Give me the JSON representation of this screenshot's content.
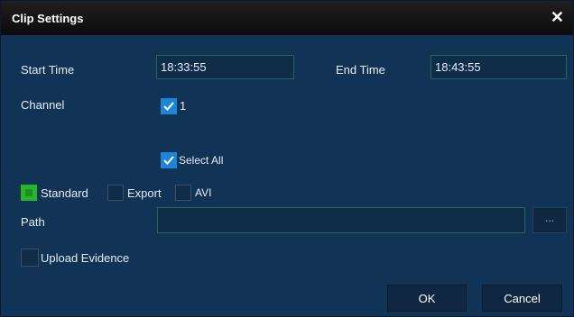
{
  "dialog": {
    "title": "Clip Settings",
    "close_glyph": "✕"
  },
  "time": {
    "start_label": "Start Time",
    "start_value": "18:33:55",
    "end_label": "End Time",
    "end_value": "18:43:55"
  },
  "channel": {
    "label": "Channel",
    "items": [
      {
        "label": "1",
        "checked": true
      }
    ],
    "select_all_label": "Select All",
    "select_all_checked": true
  },
  "format": {
    "options": [
      {
        "label": "Standard",
        "selected": true
      },
      {
        "label": "Export",
        "selected": false
      },
      {
        "label": "AVI",
        "selected": false
      }
    ]
  },
  "path": {
    "label": "Path",
    "value": "",
    "browse_label": "..."
  },
  "upload": {
    "label": "Upload Evidence",
    "checked": false
  },
  "buttons": {
    "ok": "OK",
    "cancel": "Cancel"
  },
  "colors": {
    "background": "#113355",
    "checkbox_checked": "#1b86d6",
    "radio_selected": "#28b628"
  }
}
